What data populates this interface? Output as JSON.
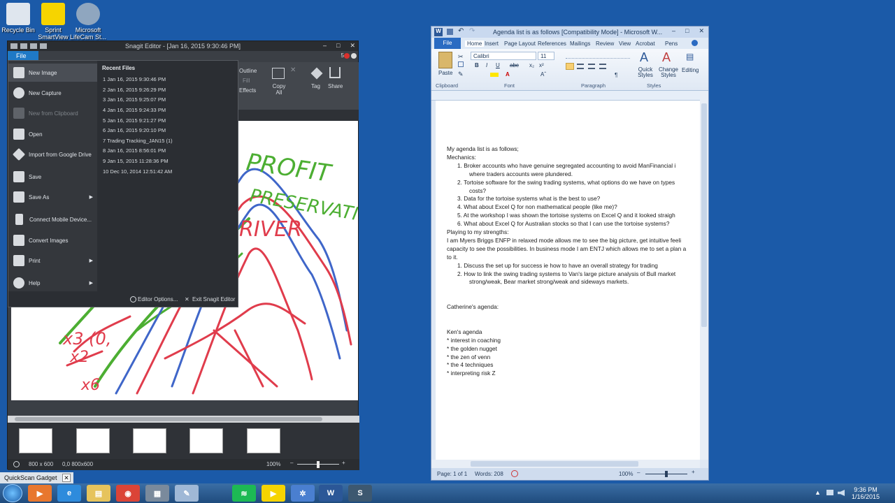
{
  "desktop": {
    "icons": [
      {
        "label": "Recycle Bin",
        "color": "#dfe6ee"
      },
      {
        "label": "Sprint SmartView",
        "color": "#f6d400"
      },
      {
        "label": "Microsoft LifeCam St...",
        "color": "#8fa6bf"
      }
    ]
  },
  "snagit": {
    "title": "Snagit Editor - [Jan 16, 2015 9:30:46 PM]",
    "file_tab": "File",
    "badge": "5",
    "ribbon": {
      "outline": "Outline",
      "fill": "Fill",
      "effects": "Effects",
      "copy_all": "Copy All",
      "tag": "Tag",
      "share": "Share"
    },
    "status": {
      "size": "800 x 600",
      "coords": "0,0  800x600",
      "zoom": "100%"
    },
    "file_menu": {
      "items": [
        {
          "label": "New Image",
          "icon": "new-image-icon",
          "selected": true,
          "disabled": false,
          "submenu": false
        },
        {
          "label": "New Capture",
          "icon": "capture-icon",
          "selected": false,
          "disabled": false,
          "submenu": false
        },
        {
          "label": "New from Clipboard",
          "icon": "clipboard-icon",
          "selected": false,
          "disabled": true,
          "submenu": false
        },
        {
          "label": "Open",
          "icon": "folder-icon",
          "selected": false,
          "disabled": false,
          "submenu": false
        },
        {
          "label": "Import from Google Drive",
          "icon": "google-drive-icon",
          "selected": false,
          "disabled": false,
          "submenu": false
        },
        {
          "label": "Save",
          "icon": "save-icon",
          "selected": false,
          "disabled": false,
          "submenu": false
        },
        {
          "label": "Save As",
          "icon": "save-as-icon",
          "selected": false,
          "disabled": false,
          "submenu": true
        },
        {
          "label": "Connect Mobile Device...",
          "icon": "mobile-device-icon",
          "selected": false,
          "disabled": false,
          "submenu": false
        },
        {
          "label": "Convert Images",
          "icon": "convert-images-icon",
          "selected": false,
          "disabled": false,
          "submenu": false
        },
        {
          "label": "Print",
          "icon": "print-icon",
          "selected": false,
          "disabled": false,
          "submenu": true
        },
        {
          "label": "Help",
          "icon": "help-icon",
          "selected": false,
          "disabled": false,
          "submenu": true
        }
      ],
      "recent_header": "Recent Files",
      "recent_files": [
        "1 Jan 16, 2015 9:30:46 PM",
        "2 Jan 16, 2015 9:26:29 PM",
        "3 Jan 16, 2015 9:25:07 PM",
        "4 Jan 16, 2015 9:24:33 PM",
        "5 Jan 16, 2015 9:21:27 PM",
        "6 Jan 16, 2015 9:20:10 PM",
        "7 Trading Tracking_JAN15 (1)",
        "8 Jan 16, 2015 8:56:01 PM",
        "9 Jan 15, 2015 11:28:36 PM",
        "10 Dec 10, 2014 12:51:42 AM"
      ],
      "editor_options": "Editor Options...",
      "exit": "Exit Snagit Editor"
    },
    "canvas_text": {
      "profit": "PROFIT",
      "preservation": "PRESERVATION",
      "river": "RIVER"
    }
  },
  "word": {
    "title": "Agenda list is as follows [Compatibility Mode] - Microsoft W...",
    "tabs": [
      "File",
      "Home",
      "Insert",
      "Page Layout",
      "References",
      "Mailings",
      "Review",
      "View",
      "Acrobat",
      "Pens"
    ],
    "font_name": "Calibri",
    "font_size": "11",
    "groups": {
      "clipboard": "Clipboard",
      "font": "Font",
      "paragraph": "Paragraph",
      "styles": "Styles"
    },
    "buttons": {
      "paste": "Paste",
      "quick_styles": "Quick Styles",
      "change_styles": "Change Styles",
      "editing": "Editing"
    },
    "document": {
      "lines": [
        {
          "text": "My agenda list is as follows;",
          "indent": 0
        },
        {
          "text": "Mechanics:",
          "indent": 0
        },
        {
          "text": "1.      Broker accounts who have genuine segregated accounting to avoid ManFinancial i",
          "indent": 1
        },
        {
          "text": "where traders accounts were plundered.",
          "indent": 2
        },
        {
          "text": "2.      Tortoise software for the swing trading systems, what options do we have on types",
          "indent": 1
        },
        {
          "text": "costs?",
          "indent": 2
        },
        {
          "text": "3.      Data for the tortoise systems what is the best to use?",
          "indent": 1
        },
        {
          "text": "4.      What about Excel Q for non mathematical people (like me)?",
          "indent": 1
        },
        {
          "text": "5.      At the workshop I was shown the tortoise systems on Excel Q and it looked straigh",
          "indent": 1
        },
        {
          "text": "6.      What about Excel Q for Australian stocks so that I can use the tortoise systems?",
          "indent": 1
        },
        {
          "text": "Playing to my strengths:",
          "indent": 0
        },
        {
          "text": "I am Myers Briggs ENFP in relaxed mode allows me to see the big picture, get intuitive feeli",
          "indent": 0
        },
        {
          "text": "capacity to see the possibilities. In business mode I am ENTJ which allows me to set a plan a",
          "indent": 0
        },
        {
          "text": "to it.",
          "indent": 0
        },
        {
          "text": "1.      Discuss the set up for success ie how to have an overall strategy for trading",
          "indent": 1
        },
        {
          "text": "2.      How to link the swing trading systems to Van's large picture analysis of Bull market",
          "indent": 1
        },
        {
          "text": "strong/weak, Bear market strong/weak and sideways markets.",
          "indent": 2
        },
        {
          "text": "",
          "indent": 0
        },
        {
          "text": "",
          "indent": 0
        },
        {
          "text": "Catherine's agenda:",
          "indent": 0
        },
        {
          "text": "",
          "indent": 0
        },
        {
          "text": "",
          "indent": 0
        },
        {
          "text": "Ken's agenda",
          "indent": 0
        },
        {
          "text": "* interest in coaching",
          "indent": 0
        },
        {
          "text": "* the golden nugget",
          "indent": 0
        },
        {
          "text": "* the zen of venn",
          "indent": 0
        },
        {
          "text": "* the 4  techniques",
          "indent": 0
        },
        {
          "text": "*  interpreting risk Z",
          "indent": 0
        }
      ]
    },
    "status": {
      "page": "Page: 1 of 1",
      "words": "Words: 208",
      "zoom": "100%"
    }
  },
  "gadget": {
    "label": "QuickScan Gadget"
  },
  "taskbar": {
    "apps": [
      {
        "icon": "media-player-icon",
        "color": "#e8772e",
        "glyph": "▶"
      },
      {
        "icon": "internet-explorer-icon",
        "color": "#2e8bdc",
        "glyph": "e"
      },
      {
        "icon": "file-explorer-icon",
        "color": "#e6c35c",
        "glyph": "▤"
      },
      {
        "icon": "chrome-icon",
        "color": "#db4437",
        "glyph": "◉"
      },
      {
        "icon": "calculator-icon",
        "color": "#7a8a9c",
        "glyph": "▦"
      },
      {
        "icon": "notepad-icon",
        "color": "#9fb8d6",
        "glyph": "✎"
      },
      {
        "icon": "spotify-icon",
        "color": "#1db954",
        "glyph": "≋"
      },
      {
        "icon": "sprint-icon",
        "color": "#f6d400",
        "glyph": "▶"
      },
      {
        "icon": "settings-icon",
        "color": "#4a7fd0",
        "glyph": "✲"
      },
      {
        "icon": "word-icon",
        "color": "#2b5797",
        "glyph": "W"
      },
      {
        "icon": "snagit-icon",
        "color": "#3d5870",
        "glyph": "S"
      }
    ],
    "time": "9:36 PM",
    "date": "1/16/2015"
  }
}
